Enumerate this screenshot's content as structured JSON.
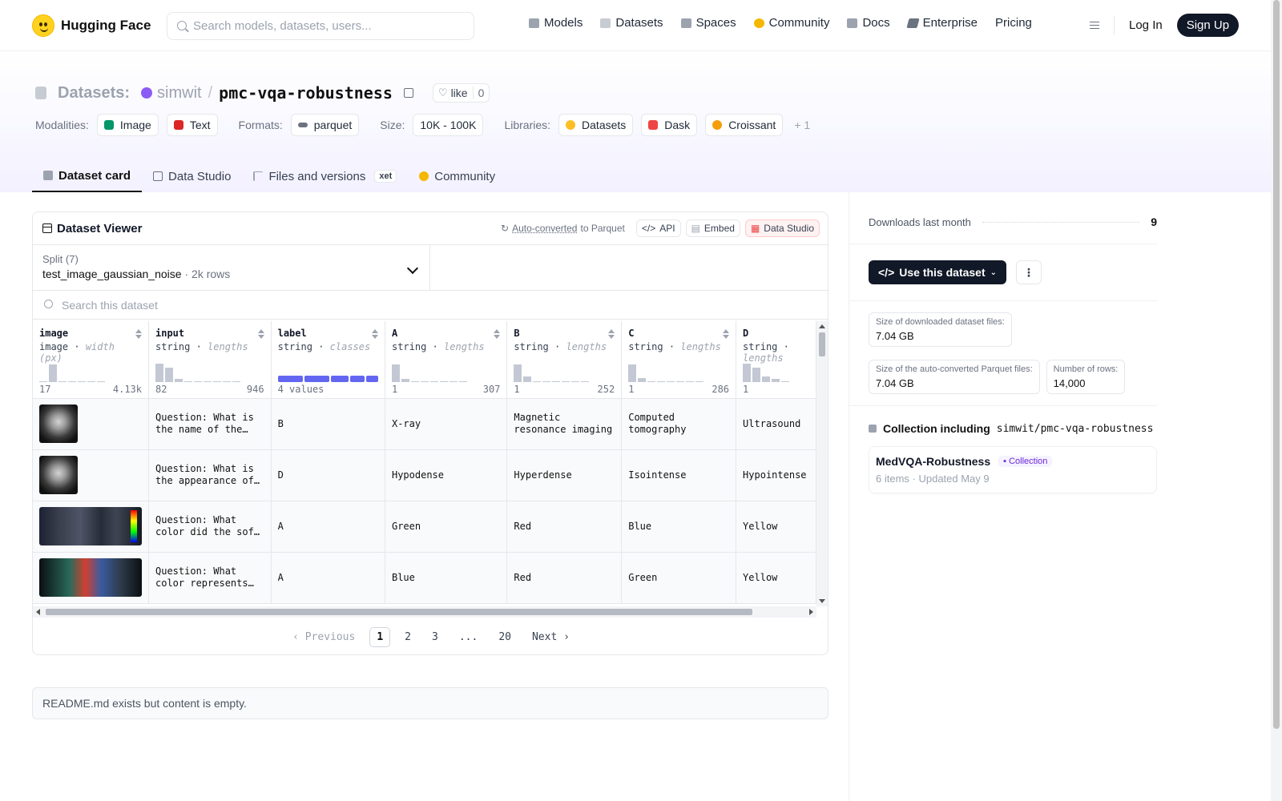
{
  "nav": {
    "brand": "Hugging Face",
    "search_placeholder": "Search models, datasets, users...",
    "links": [
      {
        "label": "Models",
        "icon": "models-icon",
        "color": "#9ca3af"
      },
      {
        "label": "Datasets",
        "icon": "datasets-icon",
        "color": "#c7cbd3"
      },
      {
        "label": "Spaces",
        "icon": "spaces-icon",
        "color": "#9ca3af"
      },
      {
        "label": "Community",
        "icon": "community-icon",
        "color": "#f5b800"
      },
      {
        "label": "Docs",
        "icon": "docs-icon",
        "color": "#9ca3af"
      },
      {
        "label": "Enterprise",
        "icon": "enterprise-icon",
        "color": "#6b7280"
      },
      {
        "label": "Pricing",
        "icon": "",
        "color": ""
      }
    ],
    "login": "Log In",
    "signup": "Sign Up"
  },
  "header": {
    "section": "Datasets:",
    "owner": "simwit",
    "repo": "pmc-vqa-robustness",
    "like_label": "like",
    "like_count": "0",
    "modalities_label": "Modalities:",
    "modalities": [
      "Image",
      "Text"
    ],
    "formats_label": "Formats:",
    "format": "parquet",
    "size_label": "Size:",
    "size": "10K - 100K",
    "libraries_label": "Libraries:",
    "libraries": [
      "Datasets",
      "Dask",
      "Croissant"
    ],
    "more_libraries": "+ 1"
  },
  "tabs": [
    {
      "label": "Dataset card",
      "active": true
    },
    {
      "label": "Data Studio",
      "active": false
    },
    {
      "label": "Files and versions",
      "active": false,
      "badge": "xet"
    },
    {
      "label": "Community",
      "active": false
    }
  ],
  "viewer": {
    "title": "Dataset Viewer",
    "auto_converted": "Auto-converted",
    "to_parquet": "to Parquet",
    "api": "API",
    "embed": "Embed",
    "data_studio": "Data Studio",
    "split_label": "Split (7)",
    "split_value": "test_image_gaussian_noise",
    "split_rows": "2k rows",
    "search_placeholder": "Search this dataset",
    "columns": [
      {
        "name": "image",
        "type": "image",
        "stat": "width (px)",
        "min": "17",
        "max": "4.13k",
        "hist": [
          0.05,
          0.85,
          0.05,
          0.05,
          0.05,
          0,
          0.05
        ]
      },
      {
        "name": "input",
        "type": "string",
        "stat": "lengths",
        "min": "82",
        "max": "946",
        "hist": [
          0.9,
          0.7,
          0.15,
          0.05,
          0.05,
          0.05,
          0.05,
          0.05,
          0.05
        ]
      },
      {
        "name": "label",
        "type": "string",
        "stat": "classes",
        "min": "4 values",
        "max": "",
        "classes": [
          0.27,
          0.26,
          0.19,
          0.15,
          0.13
        ]
      },
      {
        "name": "A",
        "type": "string",
        "stat": "lengths",
        "min": "1",
        "max": "307",
        "hist": [
          0.85,
          0.15,
          0.05,
          0.05,
          0.05,
          0.05,
          0.05,
          0.05
        ]
      },
      {
        "name": "B",
        "type": "string",
        "stat": "lengths",
        "min": "1",
        "max": "252",
        "hist": [
          0.85,
          0.25,
          0.05,
          0.05,
          0.05,
          0.05,
          0.05,
          0.05
        ]
      },
      {
        "name": "C",
        "type": "string",
        "stat": "lengths",
        "min": "1",
        "max": "286",
        "hist": [
          0.85,
          0.2,
          0.05,
          0.05,
          0.05,
          0.05,
          0.05,
          0.05
        ]
      },
      {
        "name": "D",
        "type": "string",
        "stat": "lengths",
        "min": "1",
        "max": "",
        "hist": [
          0.9,
          0.7,
          0.25,
          0.15,
          0.05
        ]
      }
    ],
    "rows": [
      {
        "image": "brain-mri",
        "input": "Question: What is the name of the…",
        "label": "B",
        "A": "X-ray",
        "B": "Magnetic resonance imaging",
        "C": "Computed tomography",
        "D": "Ultrasound"
      },
      {
        "image": "brain-mri",
        "input": "Question: What is the appearance of…",
        "label": "D",
        "A": "Hypodense",
        "B": "Hyperdense",
        "C": "Isointense",
        "D": "Hypointense"
      },
      {
        "image": "ultrasound",
        "input": "Question: What color did the soft tissue…",
        "label": "A",
        "A": "Green",
        "B": "Red",
        "C": "Blue",
        "D": "Yellow"
      },
      {
        "image": "doppler",
        "input": "Question: What color represents the…",
        "label": "A",
        "A": "Blue",
        "B": "Red",
        "C": "Green",
        "D": "Yellow"
      }
    ],
    "pager": {
      "prev": "Previous",
      "pages": [
        "1",
        "2",
        "3",
        "...",
        "20"
      ],
      "current": "1",
      "next": "Next"
    }
  },
  "readme": "README.md exists but content is empty.",
  "sidebar": {
    "downloads_label": "Downloads last month",
    "downloads": "9",
    "use_button": "Use this dataset",
    "stats": [
      {
        "k": "Size of downloaded dataset files:",
        "v": "7.04 GB"
      },
      {
        "k": "Size of the auto-converted Parquet files:",
        "v": "7.04 GB"
      },
      {
        "k": "Number of rows:",
        "v": "14,000"
      }
    ],
    "collection_heading": "Collection including",
    "collection_repo": "simwit/pmc-vqa-robustness",
    "collection": {
      "title": "MedVQA-Robustness",
      "badge": "Collection",
      "items": "6 items",
      "updated": "Updated May 9"
    }
  }
}
